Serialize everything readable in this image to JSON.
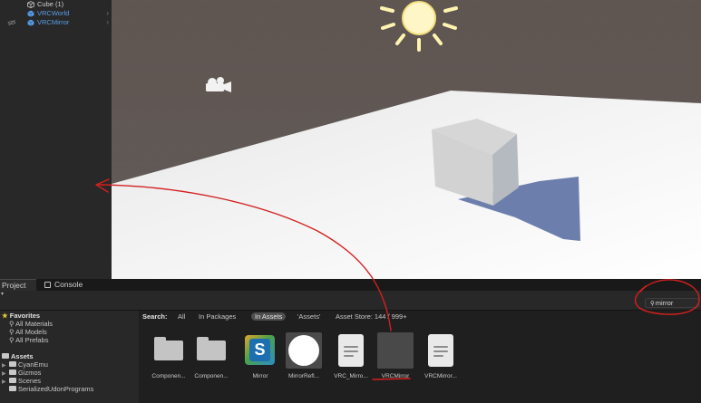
{
  "hierarchy": {
    "items": [
      {
        "label": "Cube (1)",
        "icon": "cube-icon",
        "selected": false
      },
      {
        "label": "VRCWorld",
        "icon": "prefab-icon",
        "selected": false
      },
      {
        "label": "VRCMirror",
        "icon": "prefab-icon",
        "selected": true
      }
    ]
  },
  "bottom_tabs": {
    "project": "Project",
    "console": "Console"
  },
  "search": {
    "value": "mirror",
    "icon": "search-icon"
  },
  "tree": {
    "favorites_label": "Favorites",
    "favorites": [
      "All Materials",
      "All Models",
      "All Prefabs"
    ],
    "assets_label": "Assets",
    "folders": [
      "CyanEmu",
      "Gizmos",
      "Scenes",
      "SerializedUdonPrograms"
    ]
  },
  "filter": {
    "search_label": "Search:",
    "all": "All",
    "in_packages": "In Packages",
    "in_assets": "In Assets",
    "assets_quoted": "'Assets'",
    "asset_store": "Asset Store: 144 / 999+"
  },
  "assets": [
    {
      "label": "Componen...",
      "kind": "folder"
    },
    {
      "label": "Componen...",
      "kind": "folder"
    },
    {
      "label": "Mirror",
      "kind": "shader"
    },
    {
      "label": "MirrorRefl...",
      "kind": "material"
    },
    {
      "label": "VRC_Mirro...",
      "kind": "script"
    },
    {
      "label": "VRCMirror",
      "kind": "prefab"
    },
    {
      "label": "VRCMirror...",
      "kind": "script"
    }
  ],
  "colors": {
    "annotation": "#d3201f",
    "accent_blue": "#5a9fe8",
    "favorites_star": "#e8c93a"
  }
}
